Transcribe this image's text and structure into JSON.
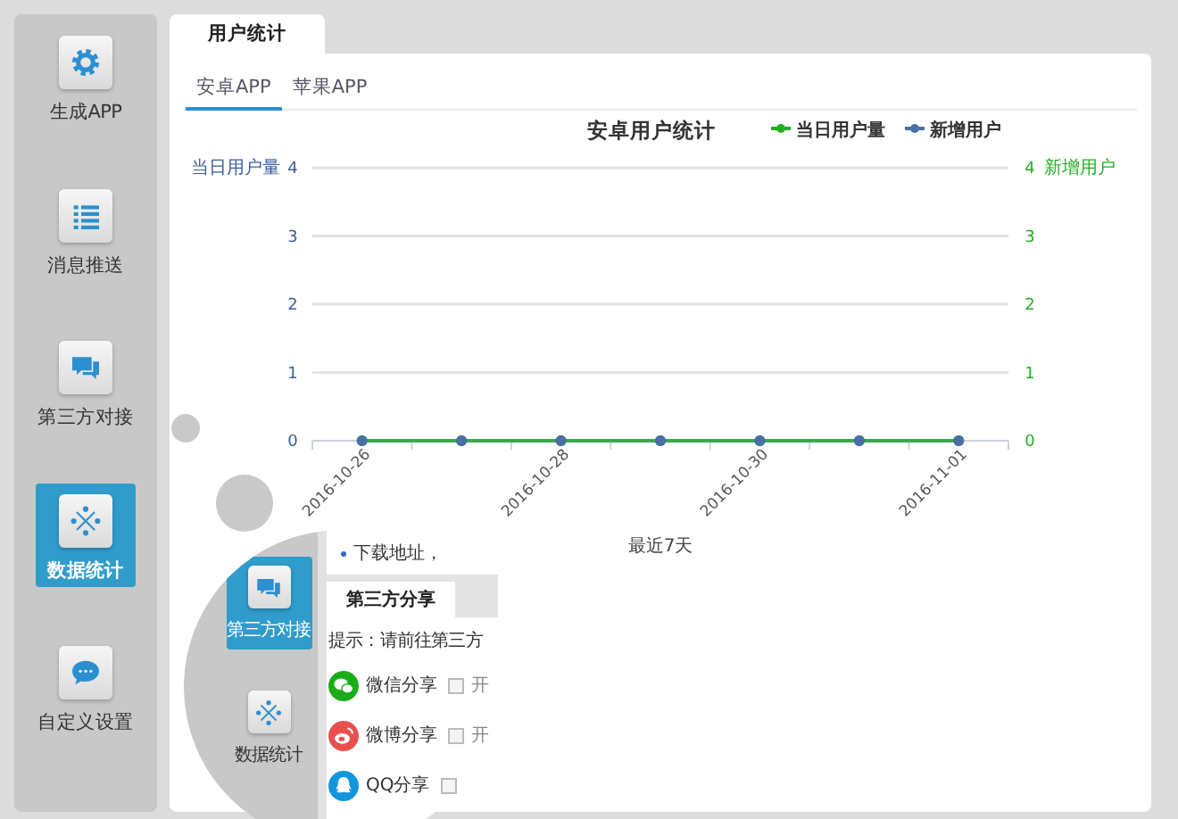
{
  "sidebar": {
    "items": [
      {
        "label": "生成APP",
        "selected": false
      },
      {
        "label": "消息推送",
        "selected": false
      },
      {
        "label": "第三方对接",
        "selected": false
      },
      {
        "label": "数据统计",
        "selected": true
      },
      {
        "label": "自定义设置",
        "selected": false
      }
    ]
  },
  "main": {
    "tabs": [
      {
        "label": "用户统计",
        "selected": true
      }
    ],
    "subtabs": [
      {
        "label": "安卓APP",
        "selected": true
      },
      {
        "label": "苹果APP",
        "selected": false
      }
    ],
    "chart": {
      "chart_data": {
        "type": "line",
        "title": "安卓用户统计",
        "xlabel": "最近7天",
        "ylabel": "当日用户量",
        "y2label": "新增用户",
        "categories": [
          "2016-10-26",
          null,
          "2016-10-28",
          null,
          "2016-10-30",
          null,
          "2016-11-01"
        ],
        "ylim": [
          0,
          4
        ],
        "yticks": [
          0,
          1,
          2,
          3,
          4
        ],
        "y2lim": [
          0,
          4
        ],
        "y2ticks": [
          0,
          1,
          2,
          3,
          4
        ],
        "grid": true,
        "legend": "top-right",
        "series": [
          {
            "name": "当日用户量",
            "color": "#22b022",
            "marker": "circle",
            "values": [
              0,
              0,
              0,
              0,
              0,
              0,
              0
            ]
          },
          {
            "name": "新增用户",
            "color": "#4a6fa5",
            "marker": "circle",
            "values": [
              0,
              0,
              0,
              0,
              0,
              0,
              0
            ]
          }
        ]
      }
    }
  },
  "magnifier": {
    "sidebar_items": [
      {
        "label": "第三方对接",
        "selected": true
      },
      {
        "label": "数据统计",
        "selected": false
      }
    ],
    "download_label": "下载地址，",
    "panel_tab": "第三方分享",
    "hint": "提示：请前往第三方",
    "share_options": [
      {
        "label": "微信分享",
        "checked": false,
        "option": "开"
      },
      {
        "label": "微博分享",
        "checked": false,
        "option": "开"
      },
      {
        "label": "QQ分享",
        "checked": false
      }
    ]
  }
}
